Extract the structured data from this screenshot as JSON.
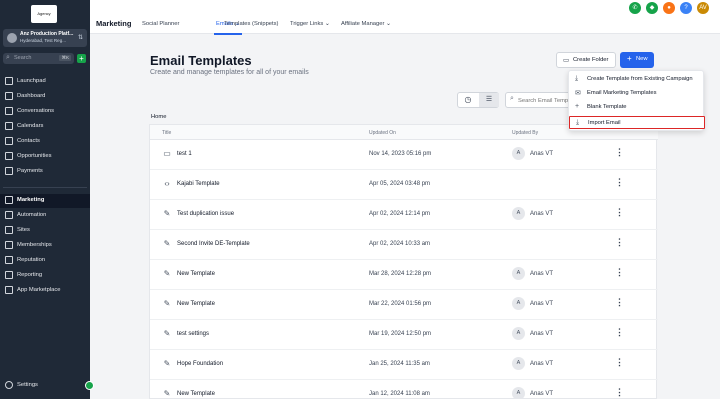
{
  "sidebar": {
    "logo_text": "Agency",
    "account": {
      "name": "Anz Production Platf...",
      "location": "Hyderabad, Test Reg..."
    },
    "search": {
      "placeholder": "Search",
      "shortcut": "⌘K"
    },
    "nav_top": [
      {
        "label": "Launchpad",
        "icon": "rocket-icon"
      },
      {
        "label": "Dashboard",
        "icon": "dashboard-icon"
      },
      {
        "label": "Conversations",
        "icon": "chat-icon"
      },
      {
        "label": "Calendars",
        "icon": "calendar-icon"
      },
      {
        "label": "Contacts",
        "icon": "contacts-icon"
      },
      {
        "label": "Opportunities",
        "icon": "funnel-icon"
      },
      {
        "label": "Payments",
        "icon": "payments-icon"
      }
    ],
    "nav_bottom": [
      {
        "label": "Marketing",
        "icon": "send-icon"
      },
      {
        "label": "Automation",
        "icon": "automation-icon"
      },
      {
        "label": "Sites",
        "icon": "globe-icon"
      },
      {
        "label": "Memberships",
        "icon": "membership-icon"
      },
      {
        "label": "Reputation",
        "icon": "star-icon"
      },
      {
        "label": "Reporting",
        "icon": "chart-icon"
      },
      {
        "label": "App Marketplace",
        "icon": "grid-icon"
      }
    ],
    "settings": "Settings"
  },
  "topbar": {
    "section": "Marketing",
    "tabs": [
      "Social Planner",
      "Emails",
      "Templates (Snippets)",
      "Trigger Links",
      "Affiliate Manager"
    ],
    "avatar": "AV"
  },
  "page": {
    "title": "Email Templates",
    "subtitle": "Create and manage templates for all of your emails",
    "create_folder": "Create Folder",
    "new_button": "New",
    "search_placeholder": "Search Email Templates",
    "breadcrumb": "Home"
  },
  "table": {
    "headers": [
      "Title",
      "Updated On",
      "Updated By"
    ],
    "rows": [
      {
        "title": "test 1",
        "icon": "folder-icon",
        "updated_on": "Nov 14, 2023 05:16 pm",
        "by_initial": "A",
        "by": "Anas VT"
      },
      {
        "title": "Kajabi Template",
        "icon": "code-icon",
        "updated_on": "Apr 05, 2024 03:48 pm",
        "by_initial": "",
        "by": ""
      },
      {
        "title": "Test duplication issue",
        "icon": "edit-icon",
        "updated_on": "Apr 02, 2024 12:14 pm",
        "by_initial": "A",
        "by": "Anas VT"
      },
      {
        "title": "Second Invite DE-Template",
        "icon": "edit-icon",
        "updated_on": "Apr 02, 2024 10:33 am",
        "by_initial": "",
        "by": ""
      },
      {
        "title": "New Template",
        "icon": "edit-icon",
        "updated_on": "Mar 28, 2024 12:28 pm",
        "by_initial": "A",
        "by": "Anas VT"
      },
      {
        "title": "New Template",
        "icon": "edit-icon",
        "updated_on": "Mar 22, 2024 01:56 pm",
        "by_initial": "A",
        "by": "Anas VT"
      },
      {
        "title": "test settings",
        "icon": "edit-icon",
        "updated_on": "Mar 19, 2024 12:50 pm",
        "by_initial": "A",
        "by": "Anas VT"
      },
      {
        "title": "Hope Foundation",
        "icon": "edit-icon",
        "updated_on": "Jan 25, 2024 11:35 am",
        "by_initial": "A",
        "by": "Anas VT"
      },
      {
        "title": "New Template",
        "icon": "edit-icon",
        "updated_on": "Jan 12, 2024 11:08 am",
        "by_initial": "A",
        "by": "Anas VT"
      }
    ]
  },
  "dropdown": {
    "items": [
      {
        "label": "Create Template from Existing Campaign",
        "icon": "download-icon"
      },
      {
        "label": "Email Marketing Templates",
        "icon": "mail-icon"
      },
      {
        "label": "Blank Template",
        "icon": "plus-icon"
      },
      {
        "label": "Import Email",
        "icon": "import-icon"
      }
    ]
  },
  "colors": {
    "accent": "#2563eb",
    "sidebar": "#1f2937",
    "highlight": "#dc2626"
  }
}
